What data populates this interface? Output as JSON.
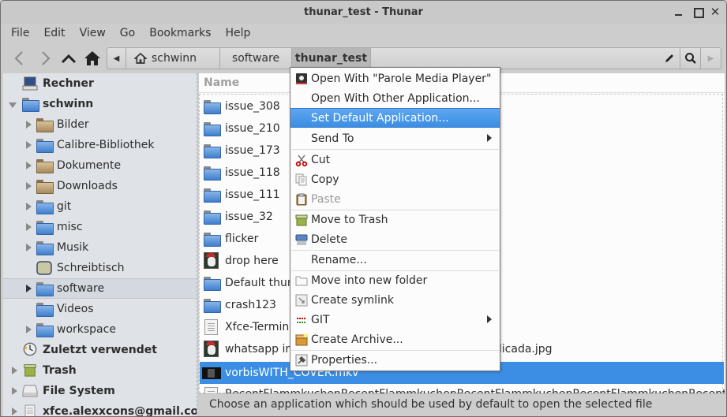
{
  "window": {
    "title": "thunar_test - Thunar",
    "controls": {
      "minimize": "minimize",
      "maximize": "maximize",
      "close": "✕"
    }
  },
  "menubar": [
    "File",
    "Edit",
    "View",
    "Go",
    "Bookmarks",
    "Help"
  ],
  "toolbar": {
    "back_icon": "chevron-left",
    "forward_icon": "chevron-right",
    "up_icon": "chevron-up",
    "home_icon": "home",
    "path": {
      "scroll_left_icon": "◀",
      "home_segment": "schwinn",
      "segments": [
        "software",
        "thunar_test"
      ],
      "active_segment": "thunar_test",
      "edit_icon": "pencil",
      "search_icon": "magnifier",
      "scroll_right_icon": "▶"
    }
  },
  "sidebar": {
    "items": [
      {
        "label": "Rechner",
        "bold": true,
        "icon": "computer"
      },
      {
        "label": "schwinn",
        "bold": true,
        "icon": "home-folder",
        "expanded": true
      },
      {
        "label": "Bilder",
        "icon": "pictures-folder",
        "expander": true
      },
      {
        "label": "Calibre-Bibliothek",
        "icon": "folder",
        "expander": true
      },
      {
        "label": "Dokumente",
        "icon": "documents-folder",
        "expander": true
      },
      {
        "label": "Downloads",
        "icon": "downloads-folder",
        "expander": true
      },
      {
        "label": "git",
        "icon": "folder",
        "expander": true
      },
      {
        "label": "misc",
        "icon": "folder",
        "expander": true
      },
      {
        "label": "Musik",
        "icon": "folder",
        "expander": true
      },
      {
        "label": "Schreibtisch",
        "icon": "desktop"
      },
      {
        "label": "software",
        "icon": "folder",
        "expander": true,
        "selected": true
      },
      {
        "label": "Videos",
        "icon": "folder"
      },
      {
        "label": "workspace",
        "icon": "folder",
        "expander": true
      },
      {
        "label": "Zuletzt verwendet",
        "bold": true,
        "icon": "recent-clock"
      },
      {
        "label": "Trash",
        "bold": true,
        "icon": "trash",
        "expander": true
      },
      {
        "label": "File System",
        "bold": true,
        "icon": "drive",
        "expander": true
      },
      {
        "label": "xfce.alexxcons@gmail.com",
        "bold": true,
        "icon": "network-drive",
        "expander": true
      }
    ]
  },
  "filelist": {
    "column_header": "Name",
    "rows": [
      {
        "name": "issue_308",
        "type": "folder"
      },
      {
        "name": "issue_210",
        "type": "folder"
      },
      {
        "name": "issue_173",
        "type": "folder"
      },
      {
        "name": "issue_118",
        "type": "folder"
      },
      {
        "name": "issue_111",
        "type": "folder"
      },
      {
        "name": "issue_32",
        "type": "folder"
      },
      {
        "name": "flicker",
        "type": "folder"
      },
      {
        "name": "drop here",
        "type": "image"
      },
      {
        "name": "Default thum",
        "type": "folder"
      },
      {
        "name": "crash123",
        "type": "folder"
      },
      {
        "name": "Xfce-Termina",
        "type": "text"
      },
      {
        "name": "whatsapp im",
        "suffix": "plicada.jpg",
        "type": "image"
      },
      {
        "name": "vorbisWITH_COVER.mkv",
        "type": "video",
        "selected": true
      },
      {
        "name": "RecentFlammkuchenRecentFlammkuchenRecentFlammkuchenRecentFlammkuchenRecentFlamm",
        "type": "document",
        "clipped": true
      }
    ]
  },
  "context_menu": {
    "items": [
      {
        "label": "Open With \"Parole Media Player\"",
        "icon": "parole-icon"
      },
      {
        "label": "Open With Other Application..."
      },
      {
        "label": "Set Default Application...",
        "highlighted": true
      },
      {
        "label": "Send To",
        "submenu": true
      },
      {
        "label": "Cut",
        "icon": "scissors"
      },
      {
        "label": "Copy",
        "icon": "copy"
      },
      {
        "label": "Paste",
        "icon": "clipboard",
        "disabled": true
      },
      {
        "label": "Move to Trash",
        "icon": "trash"
      },
      {
        "label": "Delete",
        "icon": "shredder"
      },
      {
        "label": "Rename..."
      },
      {
        "label": "Move into new folder",
        "icon": "folder-outline"
      },
      {
        "label": "Create symlink",
        "icon": "symlink"
      },
      {
        "label": "GIT",
        "icon": "git",
        "submenu": true
      },
      {
        "label": "Create Archive...",
        "icon": "archive"
      },
      {
        "label": "Properties...",
        "icon": "properties"
      }
    ]
  },
  "statusbar": {
    "text": "Choose an application which should be used by default to open the selected file"
  },
  "colors": {
    "selection": "#3b8ee3",
    "sidebar_bg": "#dfe2e7",
    "chrome_bg": "#cdcdcd"
  }
}
